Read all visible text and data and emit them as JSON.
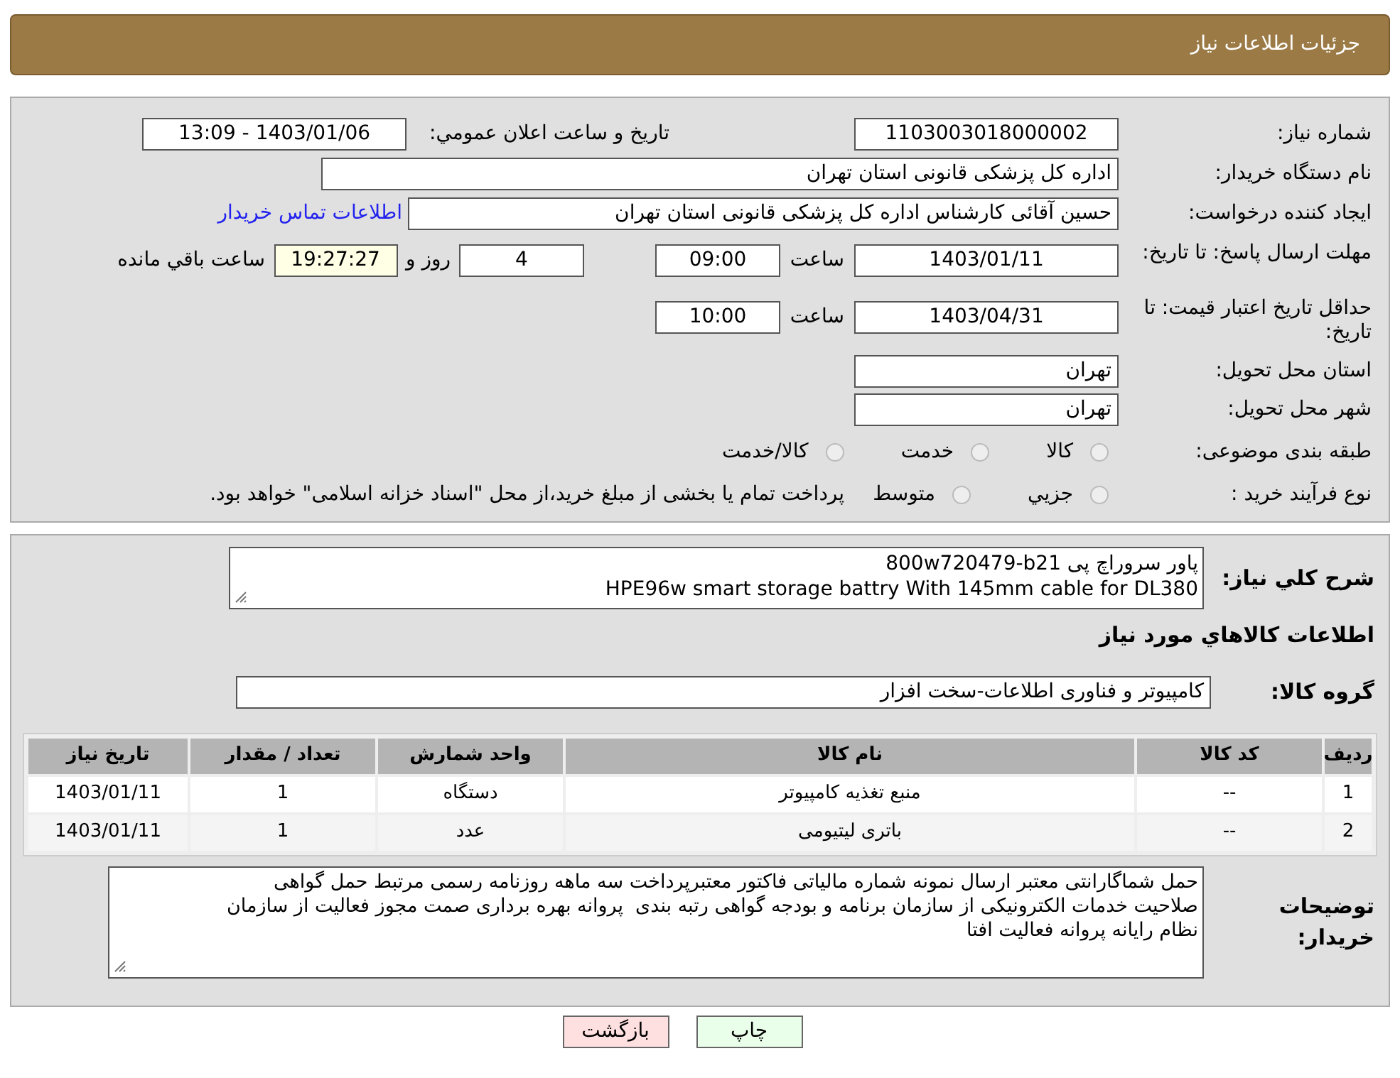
{
  "header": {
    "title": "جزئیات اطلاعات نیاز"
  },
  "need_number": {
    "label": "شماره نياز:",
    "value": "1103003018000002"
  },
  "announce": {
    "label": "تاريخ و ساعت اعلان عمومي:",
    "value": "1403/01/06 - 13:09"
  },
  "buyer": {
    "label": "نام دستگاه خريدار:",
    "value": "اداره کل پزشکی قانونی استان تهران"
  },
  "requester": {
    "label": "ايجاد کننده درخواست:",
    "value": "حسین آقائی کارشناس اداره کل پزشکی قانونی استان تهران",
    "link": "اطلاعات تماس خريدار"
  },
  "deadline": {
    "label": "مهلت ارسال پاسخ: تا تاريخ:",
    "date": "1403/01/11",
    "time_label": "ساعت",
    "time": "09:00",
    "days": "4",
    "days_label": "روز و",
    "remaining": "19:27:27",
    "remaining_label": "ساعت باقي مانده"
  },
  "validity": {
    "label": "حداقل تاريخ اعتبار قيمت: تا تاريخ:",
    "date": "1403/04/31",
    "time_label": "ساعت",
    "time": "10:00"
  },
  "province": {
    "label": "استان محل تحويل:",
    "value": "تهران"
  },
  "city": {
    "label": "شهر محل تحويل:",
    "value": "تهران"
  },
  "category": {
    "label": "طبقه بندی موضوعی:",
    "options": [
      {
        "label": "کالا",
        "selected": false
      },
      {
        "label": "خدمت",
        "selected": false
      },
      {
        "label": "کالا/خدمت",
        "selected": false
      }
    ]
  },
  "purchase_type": {
    "label": "نوع فرآيند خريد :",
    "options": [
      {
        "label": "جزيي",
        "selected": false
      },
      {
        "label": "متوسط",
        "selected": false
      }
    ],
    "note": "پرداخت تمام یا بخشی از مبلغ خرید،از محل \"اسناد خزانه اسلامی\" خواهد بود."
  },
  "summary": {
    "label": "شرح کلي نياز:",
    "lines": [
      "پاور سروراچ پی 800w720479-b21",
      "HPE96w smart storage battry With 145mm cable for DL380"
    ]
  },
  "goods_heading": "اطلاعات کالاهاي مورد نياز",
  "goods_group": {
    "label": "گروه کالا:",
    "value": "کامپیوتر و فناوری اطلاعات-سخت افزار"
  },
  "table": {
    "columns": [
      "رديف",
      "کد کالا",
      "نام کالا",
      "واحد شمارش",
      "تعداد / مقدار",
      "تاريخ نياز"
    ],
    "rows": [
      [
        "1",
        "--",
        "منبع تغذیه کامپیوتر",
        "دستگاه",
        "1",
        "1403/01/11"
      ],
      [
        "2",
        "--",
        "باتری لیتیومی",
        "عدد",
        "1",
        "1403/01/11"
      ]
    ]
  },
  "buyer_notes": {
    "label": "توضيحات خريدار:",
    "lines": [
      "حمل شماگارانتی معتبر ارسال نمونه شماره مالیاتی فاکتور معتبرپرداخت سه ماهه روزنامه رسمی مرتبط حمل گواهی",
      "صلاحیت خدمات الکترونیکی از سازمان برنامه و بودجه گواهی رتبه بندی  پروانه بهره برداری صمت مجوز فعالیت از سازمان",
      "نظام رایانه پروانه فعالیت افتا"
    ]
  },
  "buttons": [
    {
      "label": "چاپ",
      "kind": "print"
    },
    {
      "label": "بازگشت",
      "kind": "back"
    }
  ]
}
